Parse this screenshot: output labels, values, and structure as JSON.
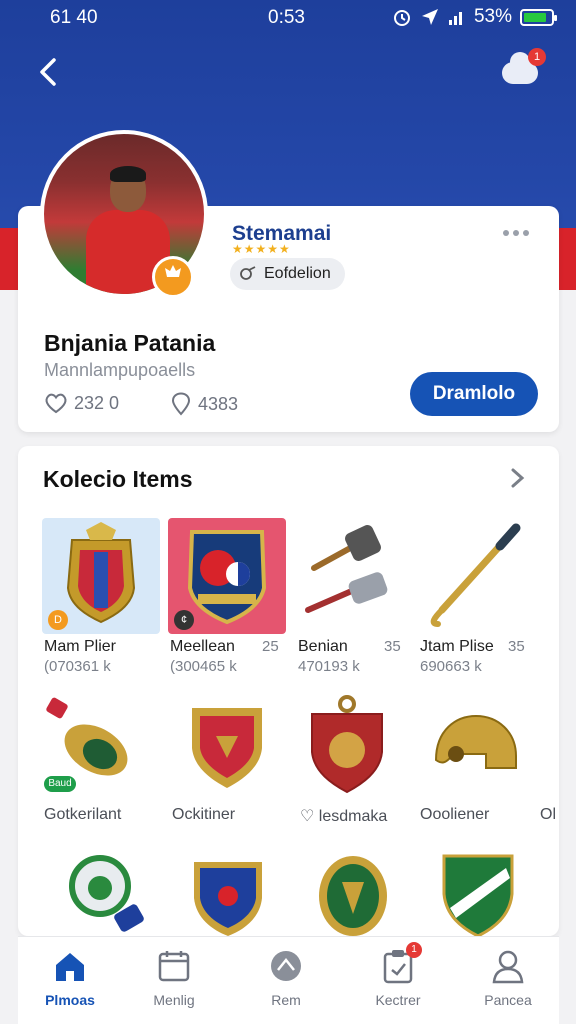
{
  "colors": {
    "brand_blue": "#1e3f9c",
    "accent_red": "#d8232a",
    "primary_button": "#1653b5",
    "badge_orange": "#f39a1f",
    "battery_green": "#27c93f"
  },
  "status_bar": {
    "left": "61 40",
    "time": "0:53",
    "battery": "53%",
    "icons": [
      "alarm-icon",
      "location-icon",
      "signal-icon",
      "battery-icon"
    ]
  },
  "header": {
    "back_icon": "chevron-left-icon",
    "cloud_icon": "cloud-icon",
    "notification_count": "1"
  },
  "profile": {
    "card_title": "Stemamai",
    "rating_stars": "★★★★★",
    "chip_label": "Eofdelion",
    "name": "Bnjania Patania",
    "handle": "Mannlampupoaells",
    "likes": "232 0",
    "favorites": "4383",
    "primary_button": "Dramlolo",
    "more_icon": "more-horizontal-icon"
  },
  "collection": {
    "title": "Kolecio Items",
    "items_row1": [
      {
        "name": "Mam Plier",
        "sub": "(070361 k",
        "num": ""
      },
      {
        "name": "Meellean",
        "sub": "(300465 k",
        "num": "25"
      },
      {
        "name": "Benian",
        "sub": "470193 k",
        "num": "35"
      },
      {
        "name": "Jtam Plise",
        "sub": "690663 k",
        "num": "35"
      }
    ],
    "items_row2": [
      {
        "name": "Gotkerilant"
      },
      {
        "name": "Ockitiner"
      },
      {
        "name": "lesdmaka"
      },
      {
        "name": "Oooliener"
      },
      {
        "name": "Ol"
      }
    ],
    "row2_tag": "Baud"
  },
  "bottom_nav": [
    {
      "label": "Plmoas",
      "icon": "home-icon",
      "active": true
    },
    {
      "label": "Menlig",
      "icon": "calendar-icon",
      "active": false
    },
    {
      "label": "Rem",
      "icon": "ball-icon",
      "active": false
    },
    {
      "label": "Kectrer",
      "icon": "clipboard-icon",
      "active": false,
      "badge": "1"
    },
    {
      "label": "Pancea",
      "icon": "user-icon",
      "active": false
    }
  ]
}
